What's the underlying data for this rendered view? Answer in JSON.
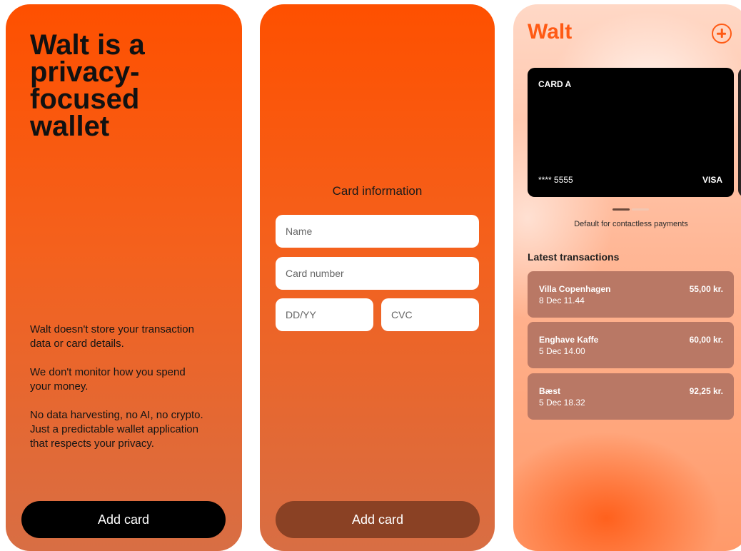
{
  "intro_screen": {
    "headline": "Walt is a privacy-focused wallet",
    "paragraphs": [
      "Walt doesn't store your transaction data or card details.",
      "We don't monitor how you spend your money.",
      "No data harvesting, no AI, no crypto. Just a predictable wallet application that respects your privacy."
    ],
    "button_label": "Add card"
  },
  "form_screen": {
    "title": "Card information",
    "name_placeholder": "Name",
    "card_number_placeholder": "Card number",
    "expiry_placeholder": "DD/YY",
    "cvc_placeholder": "CVC",
    "button_label": "Add card"
  },
  "wallet_screen": {
    "brand": "Walt",
    "add_icon": "plus-circle-icon",
    "card": {
      "name": "CARD A",
      "number": "**** 5555",
      "network": "VISA"
    },
    "pager": {
      "current": 1,
      "total": 2
    },
    "default_label": "Default for contactless payments",
    "transactions_title": "Latest transactions",
    "transactions": [
      {
        "merchant": "Villa Copenhagen",
        "date": "8 Dec 11.44",
        "amount": "55,00 kr."
      },
      {
        "merchant": "Enghave Kaffe",
        "date": "5 Dec 14.00",
        "amount": "60,00 kr."
      },
      {
        "merchant": "Bæst",
        "date": "5 Dec 18.32",
        "amount": "92,25 kr."
      }
    ]
  },
  "colors": {
    "accent": "#ff5a14",
    "orange_top": "#fe5000",
    "orange_bottom": "#d86e44",
    "card_black": "#000000",
    "transaction_bg": "#b97865",
    "disabled_button": "#8a4124"
  }
}
